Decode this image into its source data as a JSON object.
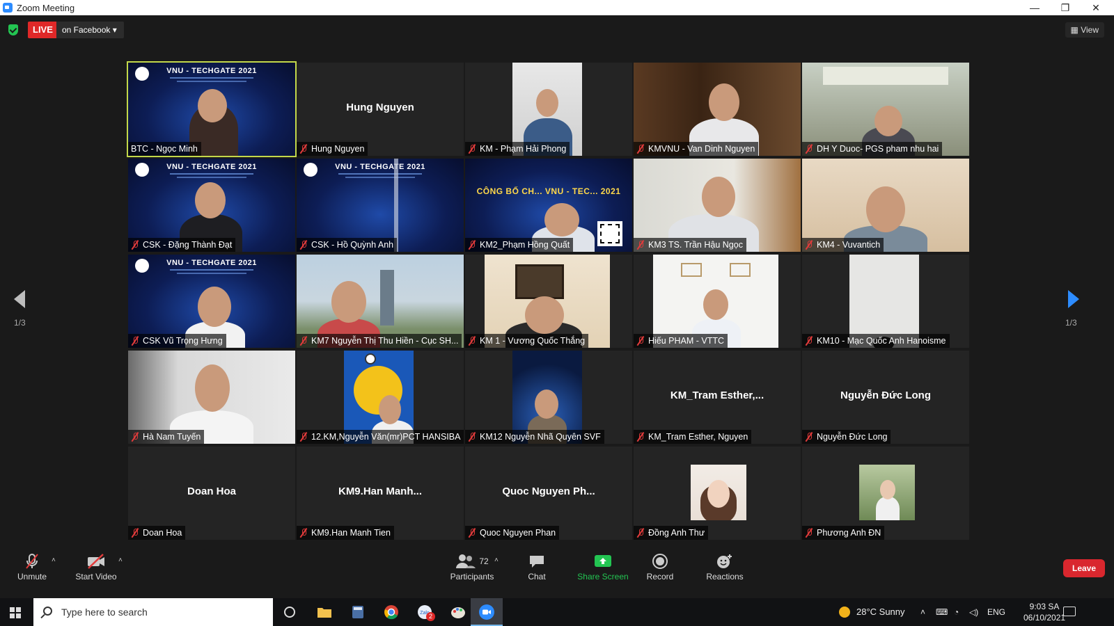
{
  "window": {
    "title": "Zoom Meeting",
    "controls": [
      "—",
      "❐",
      "✕"
    ]
  },
  "topbar": {
    "live_label": "LIVE",
    "live_destination": "on Facebook ▾",
    "view_label": "▦ View"
  },
  "gallery": {
    "page_indicator": "1/3",
    "tiles": [
      {
        "name": "BTC - Ngọc Minh",
        "display": "video",
        "muted": false,
        "active": true
      },
      {
        "name": "Hung Nguyen",
        "display": "name",
        "big_name": "Hung Nguyen",
        "muted": true
      },
      {
        "name": "KM - Phạm Hải Phong",
        "display": "video",
        "muted": true
      },
      {
        "name": "KMVNU - Van Dinh Nguyen",
        "display": "video",
        "muted": true
      },
      {
        "name": "DH Y Duoc- PGS pham nhu hai",
        "display": "video",
        "muted": true
      },
      {
        "name": "CSK - Đặng Thành Đạt",
        "display": "video",
        "muted": true
      },
      {
        "name": "CSK - Hồ Quỳnh Anh",
        "display": "video",
        "muted": true
      },
      {
        "name": "KM2_Phạm Hồng Quất",
        "display": "video",
        "muted": true
      },
      {
        "name": "KM3 TS. Trần Hậu Ngọc",
        "display": "video",
        "muted": true
      },
      {
        "name": "KM4 - Vuvantich",
        "display": "video",
        "muted": true
      },
      {
        "name": "CSK Vũ Trọng Hưng",
        "display": "video",
        "muted": true
      },
      {
        "name": "KM7 Nguyễn Thị Thu Hiền - Cục SH...",
        "display": "video",
        "muted": true
      },
      {
        "name": "KM 1 - Vương Quốc Thắng",
        "display": "video",
        "muted": true
      },
      {
        "name": "Hiếu PHAM - VTTC",
        "display": "video",
        "muted": true
      },
      {
        "name": "KM10 - Mạc Quốc Anh Hanoisme",
        "display": "video",
        "muted": true
      },
      {
        "name": "Hà Nam Tuyến",
        "display": "video",
        "muted": true
      },
      {
        "name": "12.KM,Nguyễn Văn(mr)PCT HANSIBA",
        "display": "video",
        "muted": true
      },
      {
        "name": "KM12 Nguyễn Nhã Quyên SVF",
        "display": "video",
        "muted": true
      },
      {
        "name": "KM_Tram Esther, Nguyen",
        "display": "name",
        "big_name": "KM_Tram Esther,...",
        "muted": true
      },
      {
        "name": "Nguyễn Đức Long",
        "display": "name",
        "big_name": "Nguyễn Đức Long",
        "muted": true
      },
      {
        "name": "Doan Hoa",
        "display": "name",
        "big_name": "Doan Hoa",
        "muted": true
      },
      {
        "name": "KM9.Han Manh Tien",
        "display": "name",
        "big_name": "KM9.Han Manh...",
        "muted": true
      },
      {
        "name": "Quoc Nguyen Phan",
        "display": "name",
        "big_name": "Quoc Nguyen Ph...",
        "muted": true
      },
      {
        "name": "Đồng Anh Thư",
        "display": "photo",
        "muted": true
      },
      {
        "name": "Phương Anh ĐN",
        "display": "photo",
        "muted": true
      }
    ],
    "slide_title": "VNU - TECHGATE 2021",
    "slide_title_alt": "CÔNG BỐ CH... VNU - TEC... 2021"
  },
  "toolbar": {
    "unmute": "Unmute",
    "start_video": "Start Video",
    "participants": "Participants",
    "participants_count": "72",
    "chat": "Chat",
    "share_screen": "Share Screen",
    "record": "Record",
    "reactions": "Reactions",
    "leave": "Leave"
  },
  "taskbar": {
    "search_placeholder": "Type here to search",
    "weather": "28°C  Sunny",
    "language": "ENG",
    "time": "9:03 SA",
    "date": "06/10/2021",
    "badge_count": "2"
  },
  "colors": {
    "accent": "#2d8cff",
    "live": "#e02828",
    "leave": "#d9272e",
    "share": "#23c552",
    "active_border": "#c3d84a"
  }
}
